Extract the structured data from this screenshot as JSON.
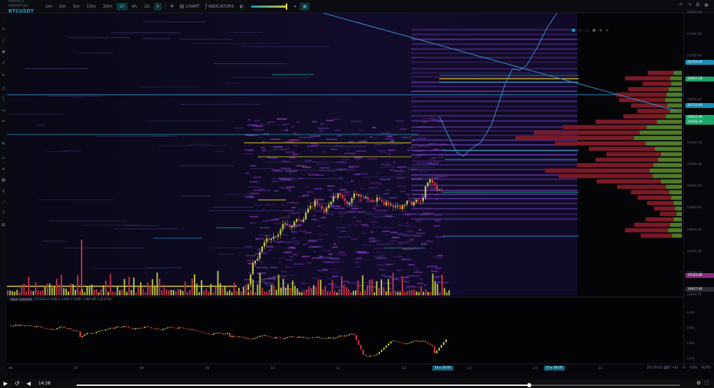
{
  "header": {
    "exchange_label": "BINANCE PERPETUAL",
    "symbol": "BTCUSDT",
    "timeframes": [
      "1m",
      "3m",
      "5m",
      "15m",
      "30m",
      "1h",
      "4h",
      "1D"
    ],
    "active_timeframe": "1h",
    "chart_button": "CHART",
    "indicators_button": "INDICATORS"
  },
  "sub_panel": {
    "title": "Open Interest",
    "readout": "O:143k H:144k L:143k C:144k +283.45 (+0.21%)"
  },
  "price_axis": {
    "labels": [
      "21600.00",
      "21400.00",
      "21200.00",
      "21000.00",
      "20800.00",
      "20600.00",
      "20400.00",
      "20200.00",
      "20000.00",
      "19800.00",
      "19600.00",
      "19400.00",
      "19200.00",
      "19000.00"
    ],
    "tags": [
      {
        "text": "21153.03",
        "color": "#1b8fb5"
      },
      {
        "text": "20997.20",
        "color": "#1aa66a"
      },
      {
        "text": "20752.60",
        "color": "#1b8fb5"
      },
      {
        "text": "20645.80",
        "color": "#1aa66a"
      },
      {
        "text": "20596.00",
        "color": "#1aa66a"
      },
      {
        "text": "19183.86",
        "color": "#8a2a7a"
      },
      {
        "text": "19057.85",
        "color": "#2a2a35"
      }
    ],
    "oi_labels": [
      "144k",
      "140k",
      "136k",
      "132k"
    ]
  },
  "time_axis": {
    "ticks": [
      "06",
      "07",
      "08",
      "09",
      "10",
      "11",
      "12",
      "13",
      "14",
      "15",
      "16"
    ],
    "status": "20:18:02 (UTC+8)",
    "log_label": "LOG",
    "auto_label": "AUTO",
    "pct_label": "%"
  },
  "player": {
    "time": "14:38",
    "progress": 0.75
  },
  "chart_data": {
    "type": "candlestick",
    "series_count": 1,
    "price_range": [
      19000,
      21600
    ],
    "volume_profile_levels": [
      {
        "price": 21050,
        "bid": 37,
        "ask": 22
      },
      {
        "price": 21000,
        "bid": 65,
        "ask": 30
      },
      {
        "price": 20950,
        "bid": 41,
        "ask": 28
      },
      {
        "price": 20900,
        "bid": 58,
        "ask": 35
      },
      {
        "price": 20850,
        "bid": 73,
        "ask": 40
      },
      {
        "price": 20800,
        "bid": 66,
        "ask": 44
      },
      {
        "price": 20750,
        "bid": 52,
        "ask": 38
      },
      {
        "price": 20700,
        "bid": 47,
        "ask": 31
      },
      {
        "price": 20650,
        "bid": 61,
        "ask": 42
      },
      {
        "price": 20600,
        "bid": 88,
        "ask": 65
      },
      {
        "price": 20550,
        "bid": 120,
        "ask": 92
      },
      {
        "price": 20500,
        "bid": 152,
        "ask": 110
      },
      {
        "price": 20450,
        "bid": 170,
        "ask": 125
      },
      {
        "price": 20400,
        "bid": 130,
        "ask": 95
      },
      {
        "price": 20350,
        "bid": 95,
        "ask": 70
      },
      {
        "price": 20300,
        "bid": 78,
        "ask": 55
      },
      {
        "price": 20250,
        "bid": 90,
        "ask": 62
      },
      {
        "price": 20200,
        "bid": 110,
        "ask": 74
      },
      {
        "price": 20150,
        "bid": 150,
        "ask": 84
      },
      {
        "price": 20100,
        "bid": 135,
        "ask": 76
      },
      {
        "price": 20050,
        "bid": 92,
        "ask": 55
      },
      {
        "price": 20000,
        "bid": 70,
        "ask": 42
      },
      {
        "price": 19950,
        "bid": 55,
        "ask": 33
      },
      {
        "price": 19900,
        "bid": 48,
        "ask": 28
      },
      {
        "price": 19850,
        "bid": 38,
        "ask": 22
      },
      {
        "price": 19800,
        "bid": 30,
        "ask": 18
      },
      {
        "price": 19750,
        "bid": 24,
        "ask": 14
      },
      {
        "price": 19700,
        "bid": 40,
        "ask": 22
      },
      {
        "price": 19650,
        "bid": 52,
        "ask": 30
      },
      {
        "price": 19600,
        "bid": 62,
        "ask": 36
      },
      {
        "price": 19550,
        "bid": 45,
        "ask": 26
      }
    ]
  }
}
